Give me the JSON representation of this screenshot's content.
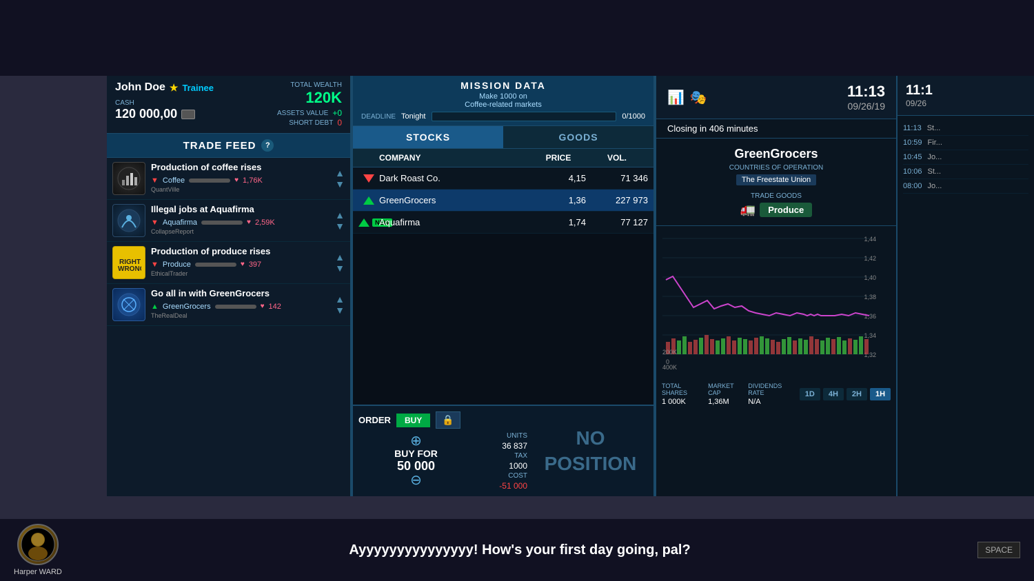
{
  "player": {
    "name": "John Doe",
    "rank": "Trainee",
    "cash_label": "CASH",
    "cash_value": "120 000,00",
    "total_wealth_label": "TOTAL WEALTH",
    "total_wealth_value": "120K",
    "assets_label": "ASSETS VALUE",
    "assets_value": "+0",
    "debt_label": "SHORT DEBT",
    "debt_value": "0"
  },
  "trade_feed": {
    "title": "TRADE FEED",
    "help": "?",
    "items": [
      {
        "source": "QuantVille",
        "headline": "Production of coffee rises",
        "ticker": "Coffee",
        "trend": "down",
        "likes": "1,76K"
      },
      {
        "source": "CollapseReport",
        "headline": "Illegal jobs at Aquafirma",
        "ticker": "Aquafirma",
        "trend": "down",
        "likes": "2,59K"
      },
      {
        "source": "EthicalTrader",
        "headline": "Production of produce rises",
        "ticker": "Produce",
        "trend": "down",
        "likes": "397"
      },
      {
        "source": "TheRealDeal",
        "headline": "Go all in with GreenGrocers",
        "ticker": "GreenGrocers",
        "trend": "up",
        "likes": "142"
      }
    ]
  },
  "mission": {
    "title": "MISSION DATA",
    "description_line1": "Make 1000 on",
    "description_line2": "Coffee-related markets",
    "deadline_label": "DEADLINE",
    "deadline_value": "Tonight",
    "progress": "0/1000"
  },
  "tabs": {
    "stocks_label": "STOCKS",
    "goods_label": "GOODS"
  },
  "stocks_table": {
    "col_company": "COMPANY",
    "col_price": "PRICE",
    "col_vol": "VOL.",
    "rows": [
      {
        "name": "Dark Roast Co.",
        "price": "4,15",
        "vol": "71 346",
        "trend": "down"
      },
      {
        "name": "GreenGrocers",
        "price": "1,36",
        "vol": "227 973",
        "trend": "up",
        "selected": true
      },
      {
        "name": "Aquafirma",
        "price": "1,74",
        "vol": "77 127",
        "trend": "up_new",
        "is_new": true
      }
    ]
  },
  "order": {
    "label": "ORDER",
    "buy_label": "BUY",
    "buy_for_label": "BUY FOR",
    "buy_for_value": "50 000",
    "units_label": "UNITS",
    "units_value": "36 837",
    "tax_label": "TAX",
    "tax_value": "1000",
    "cost_label": "COST",
    "cost_value": "-51 000",
    "no_position": "NO\nPOSITION"
  },
  "company_detail": {
    "name": "GreenGrocers",
    "countries_label": "COUNTRIES OF OPERATION",
    "country": "The Freestate Union",
    "trade_goods_label": "TRADE GOODS",
    "trade_good": "Produce"
  },
  "chart": {
    "y_labels": [
      "1,44",
      "1,42",
      "1,4",
      "1,38",
      "1,36",
      "1,34",
      "1,32"
    ],
    "x_labels": [
      "400K",
      "200K",
      "0"
    ],
    "total_shares_label": "TOTAL SHARES",
    "total_shares_value": "1 000K",
    "market_cap_label": "MARKET CAP",
    "market_cap_value": "1,36M",
    "dividends_label": "DIVIDENDS RATE",
    "dividends_value": "N/A",
    "timeframes": [
      "1D",
      "4H",
      "2H",
      "1H"
    ],
    "active_timeframe": "1H"
  },
  "clock": {
    "time": "11:13",
    "date": "09/26/19",
    "closing_text": "Closing in 406 minutes"
  },
  "far_right": {
    "time": "11:1",
    "date": "09/26",
    "activities": [
      {
        "time": "11:13",
        "desc": "St..."
      },
      {
        "time": "10:59",
        "desc": "Fir..."
      },
      {
        "time": "10:45",
        "desc": "Jo..."
      },
      {
        "time": "10:06",
        "desc": "St..."
      },
      {
        "time": "08:00",
        "desc": "Jo..."
      }
    ]
  },
  "dialogue": {
    "speaker": "Harper WARD",
    "text": "Ayyyyyyyyyyyyyyy! How's your first day going, pal?",
    "space_hint": "SPACE"
  }
}
